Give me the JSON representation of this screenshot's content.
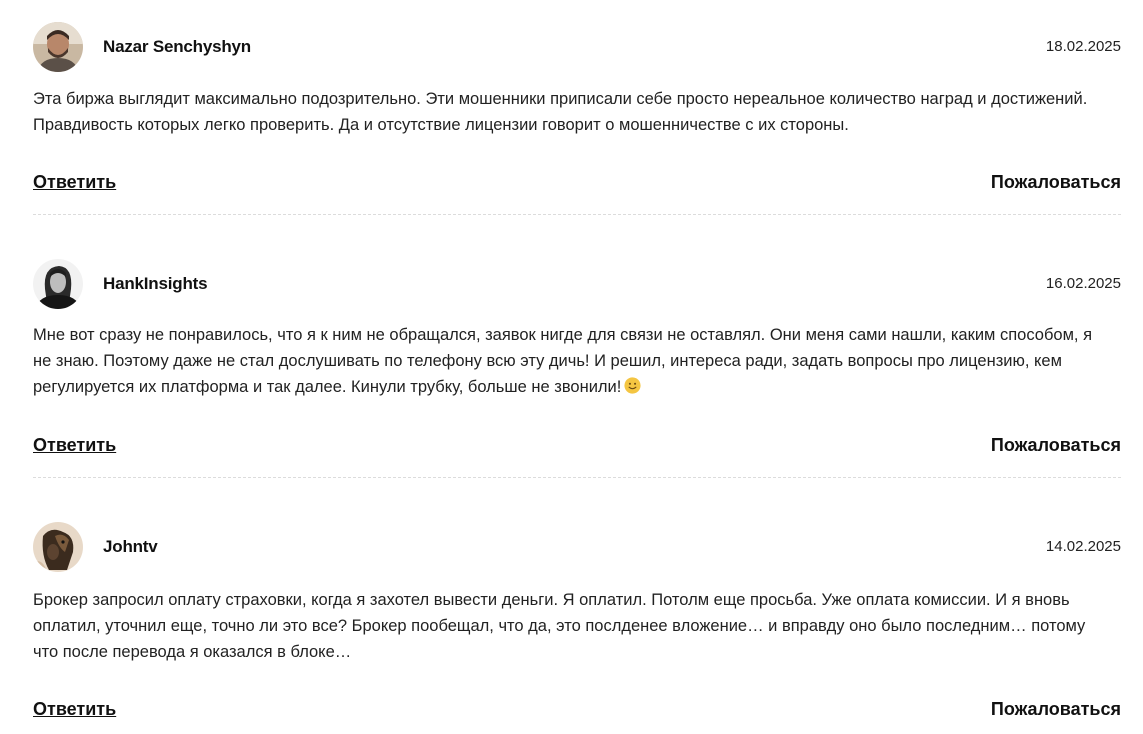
{
  "comments": [
    {
      "author": "Nazar Senchyshyn",
      "date": "18.02.2025",
      "text": "Эта биржа выглядит максимально подозрительно. Эти мошенники приписали себе просто нереальное количество наград и достижений. Правдивость которых легко проверить. Да и отсутствие лицензии говорит о мошенничестве с их стороны.",
      "reply_label": "Ответить",
      "report_label": "Пожаловаться",
      "avatar_icon": "avatar-photo-man-beard"
    },
    {
      "author": "HankInsights",
      "date": "16.02.2025",
      "text": "Мне вот сразу не понравилось, что я к ним не обращался, заявок нигде для связи не оставлял. Они меня сами нашли, каким способом, я не знаю. Поэтому даже не стал дослушивать по телефону всю эту дичь! И решил, интереса ради, задать вопросы про лицензию, кем регулируется их платформа и так далее. Кинули трубку, больше не звонили!",
      "emoji_icon": "slightly-smiling-face-emoji",
      "reply_label": "Ответить",
      "report_label": "Пожаловаться",
      "avatar_icon": "avatar-photo-man-long-hair-bw"
    },
    {
      "author": "Johntv",
      "date": "14.02.2025",
      "text": "Брокер запросил оплату страховки, когда я захотел вывести деньги. Я оплатил. Потолм еще просьба. Уже оплата комиссии. И я вновь оплатил, уточнил еще, точно ли это все? Брокер пообещал, что да, это послденее вложение… и вправду оно было последним… потому что после перевода я оказался в блоке…",
      "reply_label": "Ответить",
      "report_label": "Пожаловаться",
      "avatar_icon": "avatar-photo-dog"
    }
  ],
  "colors": {
    "text": "#222222",
    "divider": "#dcdcdc",
    "emoji": "#f4c542"
  }
}
